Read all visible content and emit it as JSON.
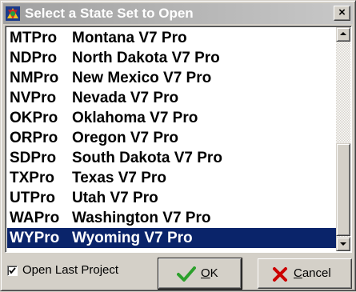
{
  "window": {
    "title": "Select a State Set to Open",
    "close_label": "×",
    "app_icon": "app-icon"
  },
  "states": [
    {
      "code": "MTPro",
      "name": "Montana V7 Pro"
    },
    {
      "code": "NDPro",
      "name": "North Dakota V7 Pro"
    },
    {
      "code": "NMPro",
      "name": "New Mexico V7 Pro"
    },
    {
      "code": "NVPro",
      "name": "Nevada V7 Pro"
    },
    {
      "code": "OKPro",
      "name": "Oklahoma V7 Pro"
    },
    {
      "code": "ORPro",
      "name": "Oregon V7 Pro"
    },
    {
      "code": "SDPro",
      "name": "South Dakota V7 Pro"
    },
    {
      "code": "TXPro",
      "name": "Texas V7 Pro"
    },
    {
      "code": "UTPro",
      "name": "Utah V7 Pro"
    },
    {
      "code": "WAPro",
      "name": "Washington V7 Pro"
    },
    {
      "code": "WYPro",
      "name": "Wyoming V7 Pro"
    }
  ],
  "selected_code": "WYPro",
  "options": {
    "open_last_project_label": "Open Last Project",
    "open_last_project_checked": true
  },
  "buttons": {
    "ok_label_hotkey": "O",
    "ok_label_rest": "K",
    "cancel_label_hotkey": "C",
    "cancel_label_rest": "ancel"
  },
  "colors": {
    "selection_bg": "#0a246a",
    "ok_check": "#2ca02c",
    "cancel_x": "#cc0000"
  }
}
